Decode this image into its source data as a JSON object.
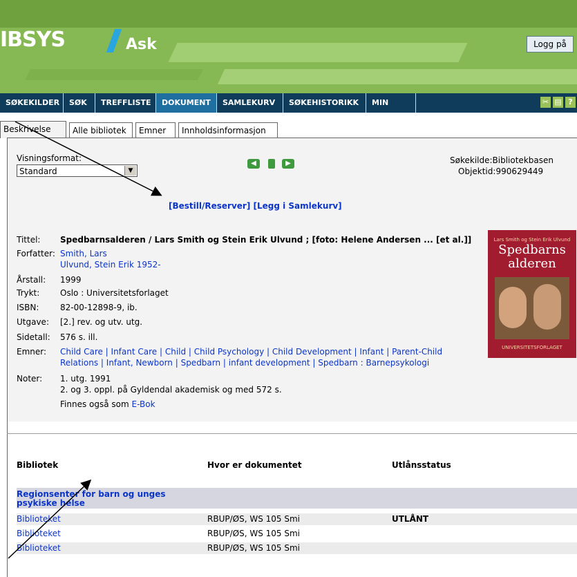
{
  "header": {
    "brand": "IBSYS",
    "app_name": "Ask",
    "login_button": "Logg på"
  },
  "nav": {
    "items": [
      "SØKEKILDER",
      "SØK",
      "TREFFLISTE",
      "DOKUMENT",
      "SAMLEKURV",
      "SØKEHISTORIKK",
      "MIN SIDE"
    ],
    "active": "DOKUMENT",
    "icons": [
      "tools-icon",
      "print-icon",
      "help-icon"
    ]
  },
  "tabs": {
    "items": [
      "Beskrivelse",
      "Alle bibliotek",
      "Emner",
      "Innholdsinformasjon"
    ],
    "active": "Beskrivelse"
  },
  "display": {
    "format_label": "Visningsformat:",
    "format_value": "Standard",
    "source_label": "Søkekilde:",
    "source_value": "Bibliotekbasen",
    "objectid_label": "Objektid:",
    "objectid_value": "990629449"
  },
  "actions": {
    "reserve": "[Bestill/Reserver]",
    "add_basket": "[Legg i Samlekurv]"
  },
  "record": {
    "title_label": "Tittel:",
    "title": "Spedbarnsalderen / Lars Smith og Stein Erik Ulvund ; [foto: Helene Andersen ... [et al.]]",
    "author_label": "Forfatter:",
    "authors": [
      "Smith, Lars",
      "Ulvund, Stein Erik 1952-"
    ],
    "year_label": "Årstall:",
    "year": "1999",
    "printed_label": "Trykt:",
    "printed": "Oslo : Universitetsforlaget",
    "isbn_label": "ISBN:",
    "isbn": "82-00-12898-9, ib.",
    "edition_label": "Utgave:",
    "edition": "[2.] rev. og utv. utg.",
    "pages_label": "Sidetall:",
    "pages": "576 s. ill.",
    "subjects_label": "Emner:",
    "subjects_line1": "Child Care | Infant Care | Child | Child Psychology | Child Development | Infant | Parent-Child",
    "subjects_line2": "Relations | Infant, Newborn | Spedbarn | infant development | Spedbarn : Barnepsykologi",
    "notes_label": "Noter:",
    "notes": [
      "1. utg. 1991",
      "2. og 3. oppl. på Gyldendal akademisk og med 572 s."
    ],
    "also_label": "Finnes også som",
    "also_link": "E-Bok"
  },
  "cover": {
    "authors": "Lars Smith og Stein Erik Ulvund",
    "title_line1": "Spedbarns",
    "title_line2": "alderen",
    "publisher": "UNIVERSITETSFORLAGET"
  },
  "holdings": {
    "headers": [
      "Bibliotek",
      "Hvor er dokumentet",
      "Utlånsstatus"
    ],
    "group": "Regionsenter for barn og unges psykiske helse",
    "rows": [
      {
        "library": "Biblioteket",
        "location": "RBUP/ØS, WS 105 Smi",
        "status": "UTLÅNT"
      },
      {
        "library": "Biblioteket",
        "location": "RBUP/ØS, WS 105 Smi",
        "status": ""
      },
      {
        "library": "Biblioteket",
        "location": "RBUP/ØS, WS 105 Smi",
        "status": ""
      }
    ]
  }
}
